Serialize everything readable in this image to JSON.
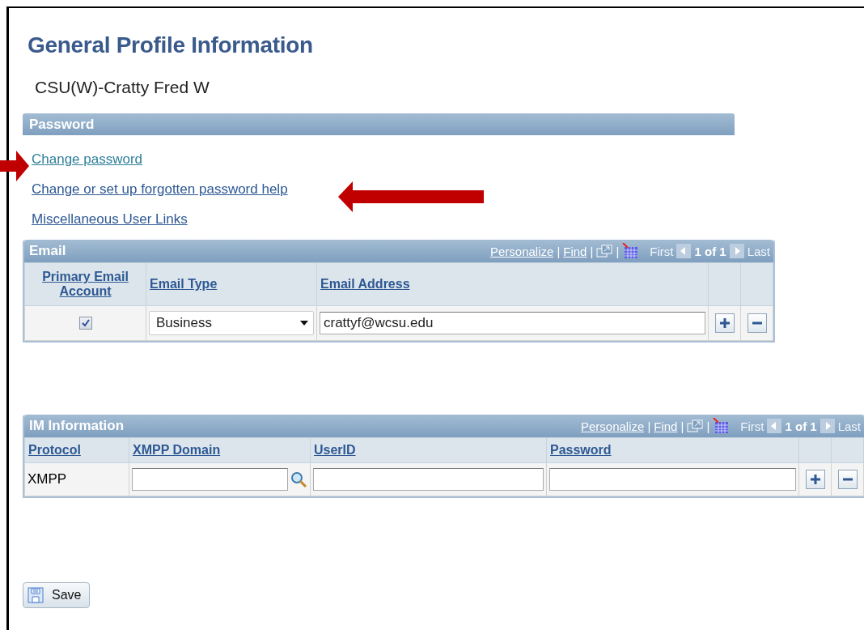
{
  "page_title": "General Profile Information",
  "user_name": "CSU(W)-Cratty Fred W",
  "password_section": {
    "title": "Password",
    "links": [
      {
        "label": "Change password",
        "visited": true
      },
      {
        "label": "Change or set up forgotten password help",
        "visited": false
      },
      {
        "label": "Miscellaneous User Links",
        "visited": false
      }
    ]
  },
  "email_grid": {
    "title": "Email",
    "toolbar": {
      "personalize": "Personalize",
      "separator": "|",
      "find": "Find",
      "first": "First",
      "count": "1 of 1",
      "last": "Last"
    },
    "columns": [
      "Primary Email Account",
      "Email Type",
      "Email Address"
    ],
    "rows": [
      {
        "primary": true,
        "type": "Business",
        "address": "crattyf@wcsu.edu"
      }
    ]
  },
  "im_grid": {
    "title": "IM Information",
    "toolbar": {
      "personalize": "Personalize",
      "separator": "|",
      "find": "Find",
      "first": "First",
      "count": "1 of 1",
      "last": "Last"
    },
    "columns": [
      "Protocol",
      "XMPP Domain",
      "UserID",
      "Password"
    ],
    "rows": [
      {
        "protocol": "XMPP"
      }
    ]
  },
  "save_button": "Save"
}
